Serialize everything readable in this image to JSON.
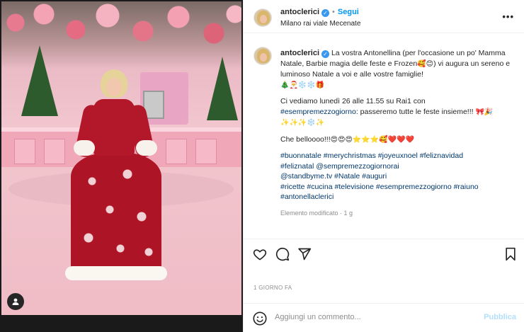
{
  "post": {
    "username": "antoclerici",
    "verified_mark": "✓",
    "separator": "•",
    "follow_label": "Segui",
    "location": "Milano rai viale Mecenate",
    "more_label": "•••"
  },
  "caption": {
    "username": "antoclerici",
    "p1": "La vostra Antonellina (per l'occasione un po' Mamma Natale, Barbie magia delle feste e Frozen",
    "p1_emoji": "🥰😊",
    "p1_tail": ") vi augura un sereno e luminoso Natale a voi e alle vostre famiglie!",
    "p1_emoji_line": "🎄🎅❄️❄️🎁",
    "p2": "Ci vediamo lunedì 26 alle 11.55 su Rai1 con",
    "p2_tag": "#esempremezzogiorno",
    "p2_tail": ": passeremo tutte le feste insieme!!! ",
    "p2_emoji": "🎀🎉",
    "p2_emoji_line": "✨✨✨❄️✨",
    "p3": "Che belloooo!!!",
    "p3_emoji": "😍😍😍⭐⭐⭐🥰❤️❤️❤️",
    "hashtags": [
      "#buonnatale",
      "#merychristmas",
      "#joyeuxnoel",
      "#feliznavidad",
      "#feliznatal",
      "@sempremezzogiornorai",
      "@standbyme.tv",
      "#Natale",
      "#auguri",
      "#ricette",
      "#cucina",
      "#televisione",
      "#esempremezzogiorno",
      "#raiuno",
      "#antonellaclerici"
    ],
    "edited": "Elemento modificato · 1 g"
  },
  "meta": {
    "date": "1 GIORNO FA"
  },
  "comment": {
    "placeholder": "Aggiungi un commento...",
    "publish_label": "Pubblica"
  },
  "icons": {
    "like": "heart-icon",
    "comment": "comment-icon",
    "share": "paper-plane-icon",
    "save": "bookmark-icon",
    "emoji": "smiley-icon",
    "author": "user-icon"
  },
  "colors": {
    "accent": "#0095f6",
    "hashtag": "#00376b",
    "publish_disabled": "#b2dffc",
    "muted": "#8e8e8e"
  }
}
